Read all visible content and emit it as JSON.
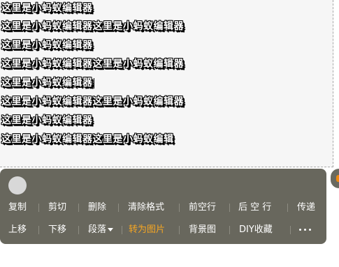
{
  "editor": {
    "lines": [
      "这里是小蚂蚁编辑器",
      "这里是小蚂蚁编辑器这里是小蚂蚁编辑器",
      "这里是小蚂蚁编辑器",
      "这里是小蚂蚁编辑器这里是小蚂蚁编辑器",
      "这里是小蚂蚁编辑器",
      "这里是小蚂蚁编辑器这里是小蚂蚁编辑器",
      "这里是小蚂蚁编辑器",
      "这里是小蚂蚁编辑器这里是小蚂蚁编辑"
    ]
  },
  "toolbar": {
    "row1": [
      "复制",
      "剪切",
      "删除",
      "清除格式",
      "前空行",
      "后 空 行",
      "传递"
    ],
    "row2": [
      "上移",
      "下移",
      "段落",
      "转为图片",
      "背景图",
      "DIY收藏"
    ]
  },
  "colors": {
    "toolbar_bg": "#68675d",
    "accent": "#f5a623",
    "editor_bg": "#f6f6f6"
  },
  "icons": {
    "circle": "circle-icon",
    "dropdown": "chevron-down-icon",
    "more": "more-icon"
  }
}
